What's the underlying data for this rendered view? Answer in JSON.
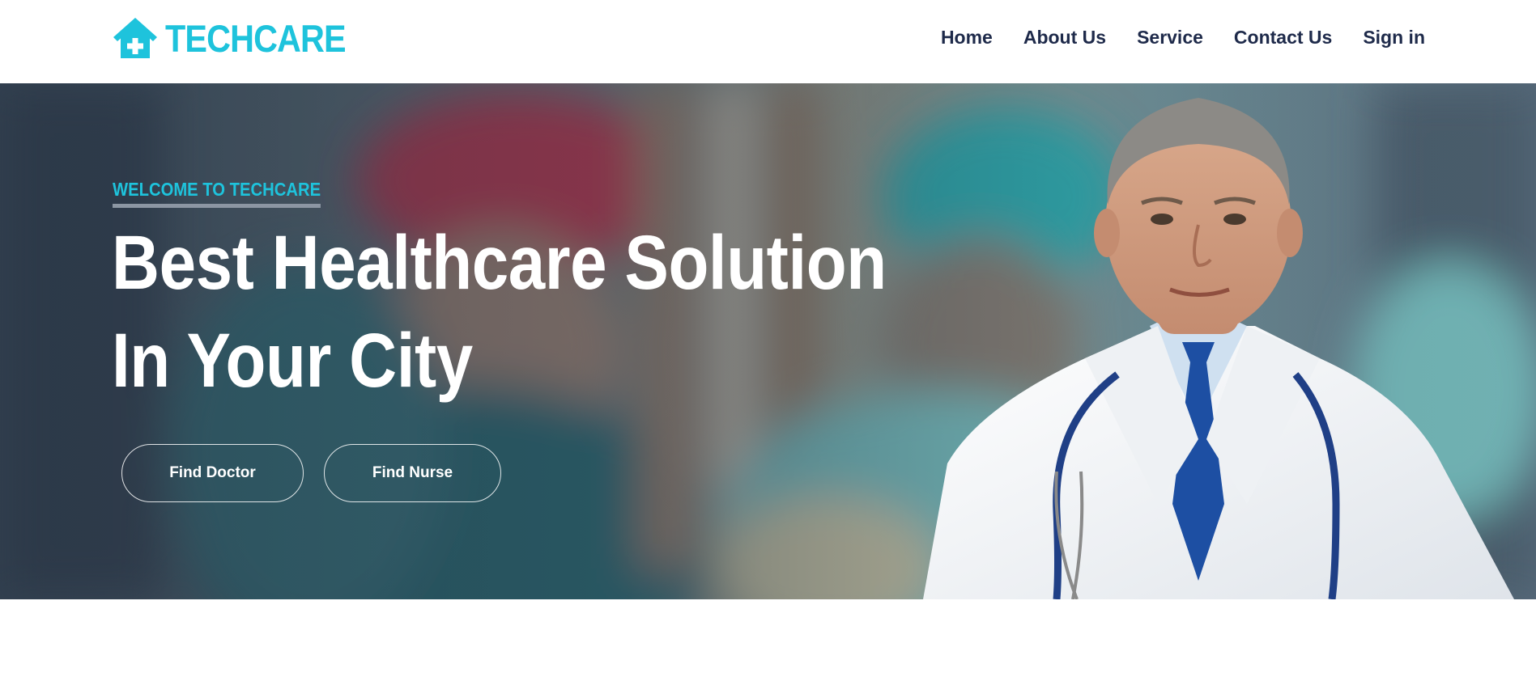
{
  "brand": {
    "name": "TECHCARE",
    "icon": "house-medical-icon",
    "color": "#1ec3dc"
  },
  "nav": {
    "color": "#1e2a4a",
    "items": [
      {
        "label": "Home"
      },
      {
        "label": "About Us"
      },
      {
        "label": "Service"
      },
      {
        "label": "Contact Us"
      },
      {
        "label": "Sign in"
      }
    ]
  },
  "hero": {
    "eyebrow": "WELCOME TO TECHCARE",
    "headline_line1": "Best Healthcare Solution",
    "headline_line2": "In Your City",
    "buttons": {
      "find_doctor": "Find Doctor",
      "find_nurse": "Find Nurse"
    },
    "accent_color": "#1ec3dc"
  }
}
